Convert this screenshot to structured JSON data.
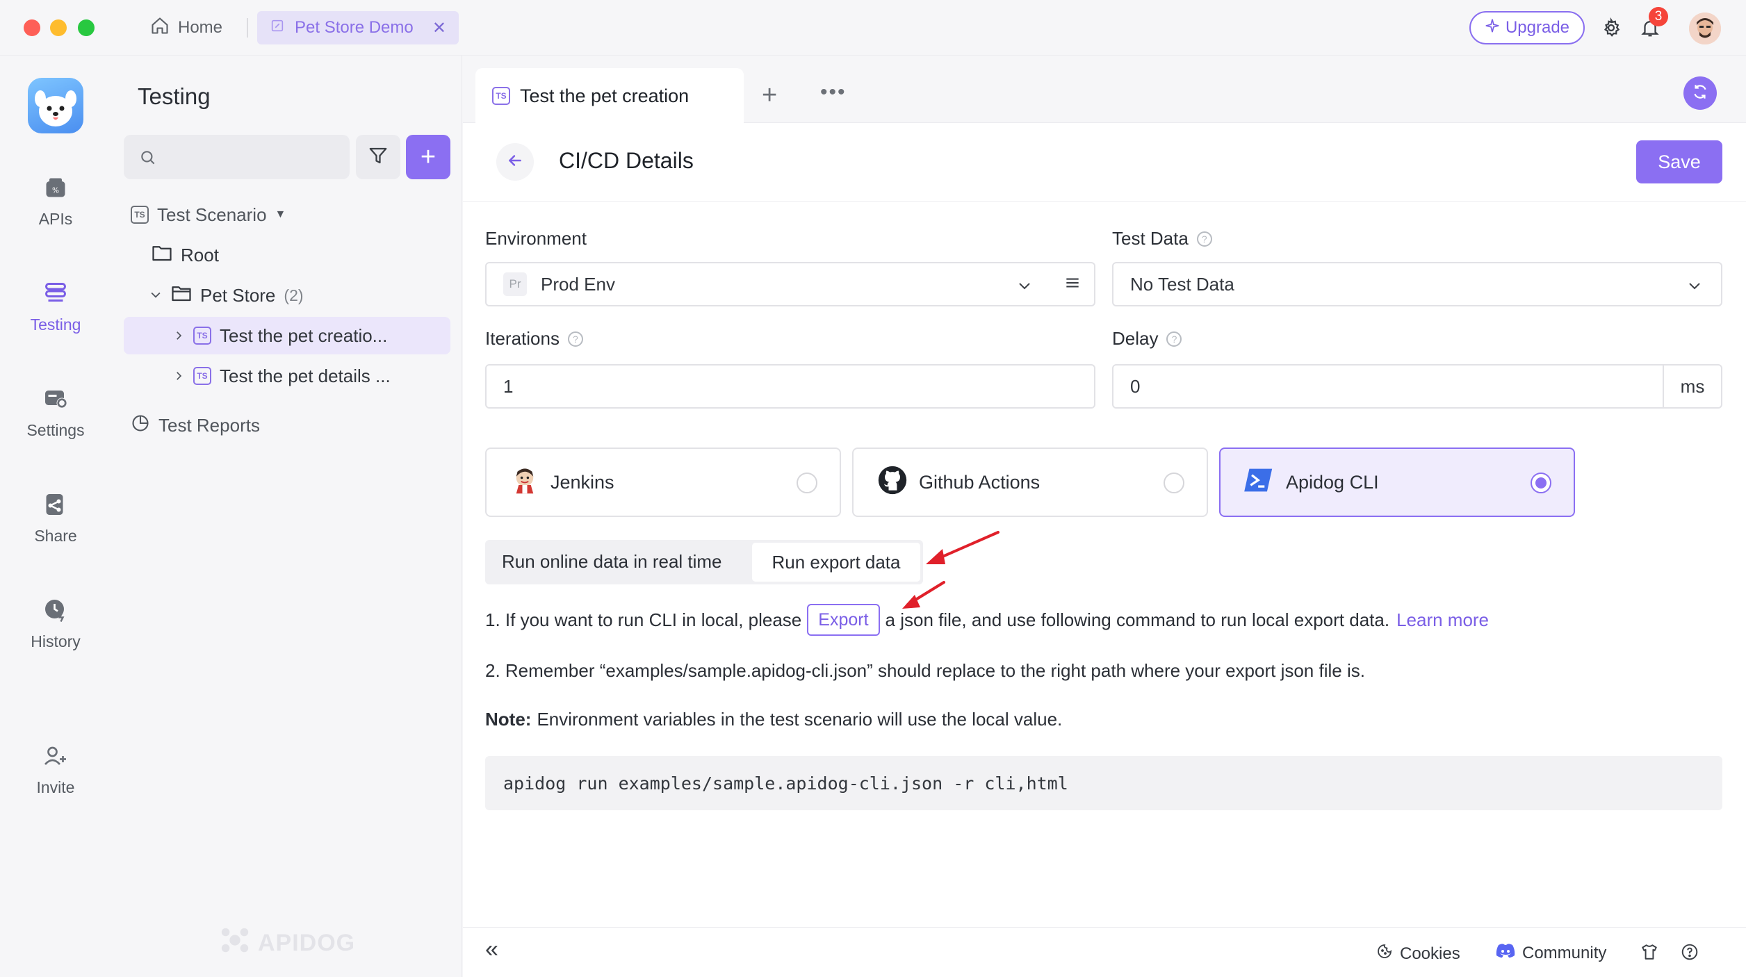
{
  "titlebar": {
    "home_label": "Home",
    "project_tab": "Pet Store Demo",
    "close_glyph": "✕",
    "upgrade_label": "Upgrade",
    "notifications_count": "3"
  },
  "rail": {
    "items": [
      {
        "label": "APIs",
        "icon": "api-icon"
      },
      {
        "label": "Testing",
        "icon": "testing-icon",
        "active": true
      },
      {
        "label": "Settings",
        "icon": "settings-icon"
      },
      {
        "label": "Share",
        "icon": "share-icon"
      },
      {
        "label": "History",
        "icon": "history-icon"
      },
      {
        "label": "Invite",
        "icon": "invite-icon"
      }
    ]
  },
  "tree": {
    "title": "Testing",
    "scenario_label": "Test Scenario",
    "root_label": "Root",
    "folder_label": "Pet Store",
    "folder_count": "(2)",
    "items": [
      "Test the pet creatio...",
      "Test the pet details ..."
    ],
    "ts_badge": "TS",
    "reports_label": "Test Reports",
    "watermark": "APIDOG"
  },
  "main": {
    "tab_label": "Test the pet creation",
    "plus_glyph": "+",
    "more_glyph": "•••",
    "page_title": "CI/CD Details",
    "save_label": "Save"
  },
  "form": {
    "environment_label": "Environment",
    "environment_tag": "Pr",
    "environment_value": "Prod Env",
    "test_data_label": "Test Data",
    "test_data_value": "No Test Data",
    "iterations_label": "Iterations",
    "iterations_value": "1",
    "delay_label": "Delay",
    "delay_value": "0",
    "delay_unit": "ms",
    "help_glyph": "?"
  },
  "ci": {
    "options": [
      {
        "label": "Jenkins",
        "selected": false
      },
      {
        "label": "Github Actions",
        "selected": false
      },
      {
        "label": "Apidog CLI",
        "selected": true
      }
    ]
  },
  "mode": {
    "option_a": "Run online data in real time",
    "option_b": "Run export data",
    "selected": "Run export data"
  },
  "instructions": {
    "line1_prefix": "1. If you want to run CLI in local, please",
    "export_label": "Export",
    "line1_suffix": "a json file, and use following command to run local export data.",
    "learn_more": "Learn more",
    "line2": "2. Remember “examples/sample.apidog-cli.json” should replace to the right path where your export json file is.",
    "note_bold": "Note:",
    "note_text": "Environment variables in the test scenario will use the local value.",
    "command": "apidog run examples/sample.apidog-cli.json -r cli,html"
  },
  "footer": {
    "collapse_glyph": "«",
    "cookies_label": "Cookies",
    "community_label": "Community"
  },
  "colors": {
    "accent": "#8b6ff2",
    "annotation_arrow": "#e0202a"
  }
}
